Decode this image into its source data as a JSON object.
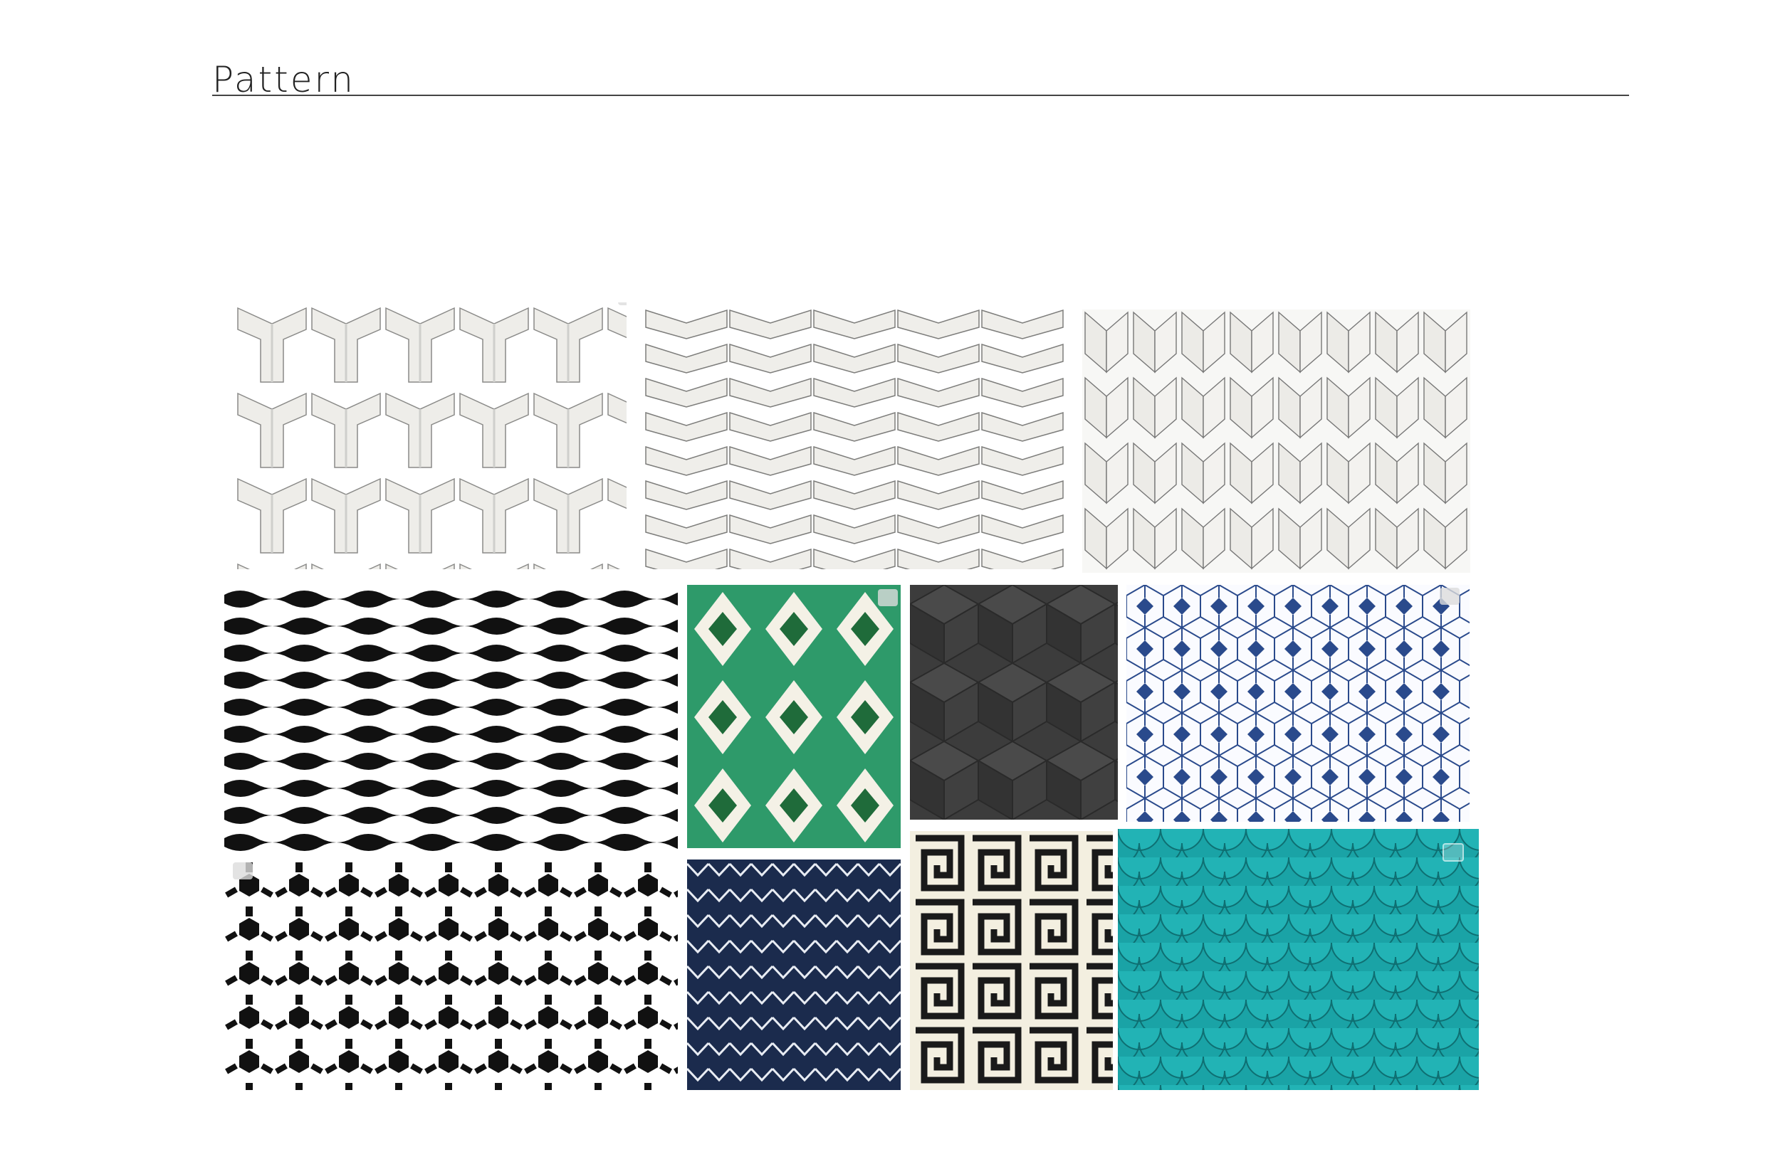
{
  "page": {
    "title": "Pattern"
  },
  "icons": {
    "expand": "expand-icon"
  },
  "colors": {
    "tile_white": "#f2f1ee",
    "green": "#2e9a6a",
    "dark_green": "#1f6b3a",
    "cream": "#f4f1e6",
    "charcoal": "#3c3c3c",
    "navy": "#1b2b4d",
    "blue": "#2a4a8c",
    "teal": "#1aa3a6"
  }
}
